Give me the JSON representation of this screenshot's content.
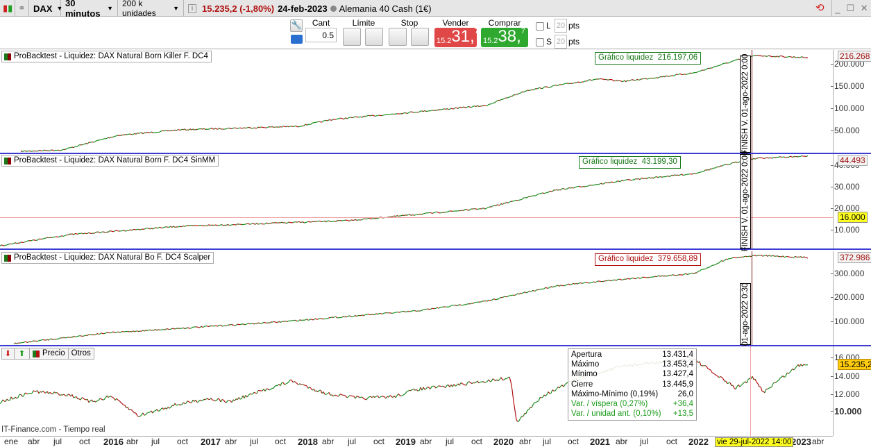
{
  "topbar": {
    "instrument": "DAX",
    "timeframe": "30 minutos",
    "units": "200 k unidades",
    "last_price": "15.235,2 (-1,80%)",
    "date": "24-feb-2023",
    "market_name": "Alemania 40 Cash (1€)",
    "price_color": "#b01010"
  },
  "order": {
    "qty_label": "Cant",
    "qty_value": "0.5",
    "limit_label": "Límite",
    "stop_label": "Stop",
    "sell_label": "Vender",
    "buy_label": "Comprar",
    "sell": {
      "prefix": "15.2",
      "big": "31,",
      "sup": "7"
    },
    "buy": {
      "prefix": "15.2",
      "big": "38,",
      "sup": "7"
    },
    "long_label": "L",
    "short_label": "S",
    "long_pts": "20",
    "short_pts": "20",
    "pts_label": "pts",
    "sell_color": "#e04848",
    "buy_color": "#2ea82e"
  },
  "panels": [
    {
      "legend": "ProBacktest - Liquidez: DAX Natural Born Killer F. DC4",
      "gl_label": "Gráfico liquidez  216.197,06",
      "last": "216.268",
      "ticks": [
        "200.000",
        "150.000",
        "100.000",
        "50.000"
      ],
      "finish": "FINISH V. 01-ago-2022 0:00"
    },
    {
      "legend": "ProBacktest - Liquidez: DAX Natural Born  F. DC4 SinMM",
      "gl_label": "Gráfico liquidez  43.199,30",
      "last": "44.493",
      "ticks": [
        "40.000",
        "30.000",
        "20.000",
        "10.000"
      ],
      "hline": "16.000",
      "finish": "FINISH V. 01-ago-2022 0:00"
    },
    {
      "legend": "ProBacktest - Liquidez: DAX Natural Bo  F. DC4 Scalper",
      "gl_label": "Gráfico liquidez  379.658,89",
      "last": "372.986",
      "ticks": [
        "300.000",
        "200.000",
        "100.000"
      ],
      "finish": "01-ago-2022 0:30"
    }
  ],
  "price_panel": {
    "tabs": [
      "Precio",
      "Otros"
    ],
    "last": "15.235,2",
    "ticks": [
      "16.000",
      "14.000",
      "12.000",
      "10.000"
    ],
    "source": "IT-Finance.com - Tiempo real",
    "cursor_label": "vie 29-jul-2022 14:00"
  },
  "tooltip": [
    {
      "k": "Apertura",
      "v": "13.431,4"
    },
    {
      "k": "Máximo",
      "v": "13.453,4"
    },
    {
      "k": "Mínimo",
      "v": "13.427,4"
    },
    {
      "k": "Cierre",
      "v": "13.445,9"
    },
    {
      "k": "Máximo-Mínimo (0,19%)",
      "v": "26,0"
    },
    {
      "k": "Var. / víspera (0,27%)",
      "v": "+36,4",
      "green": true
    },
    {
      "k": "Var. / unidad ant. (0,10%)",
      "v": "+13,5",
      "green": true
    }
  ],
  "xaxis": [
    "ene",
    "abr",
    "jul",
    "oct",
    "2016",
    "abr",
    "jul",
    "oct",
    "2017",
    "abr",
    "jul",
    "oct",
    "2018",
    "abr",
    "jul",
    "oct",
    "2019",
    "abr",
    "jul",
    "oct",
    "2020",
    "abr",
    "jul",
    "oct",
    "2021",
    "abr",
    "jul",
    "oct",
    "2022",
    "2023",
    "abr"
  ]
}
